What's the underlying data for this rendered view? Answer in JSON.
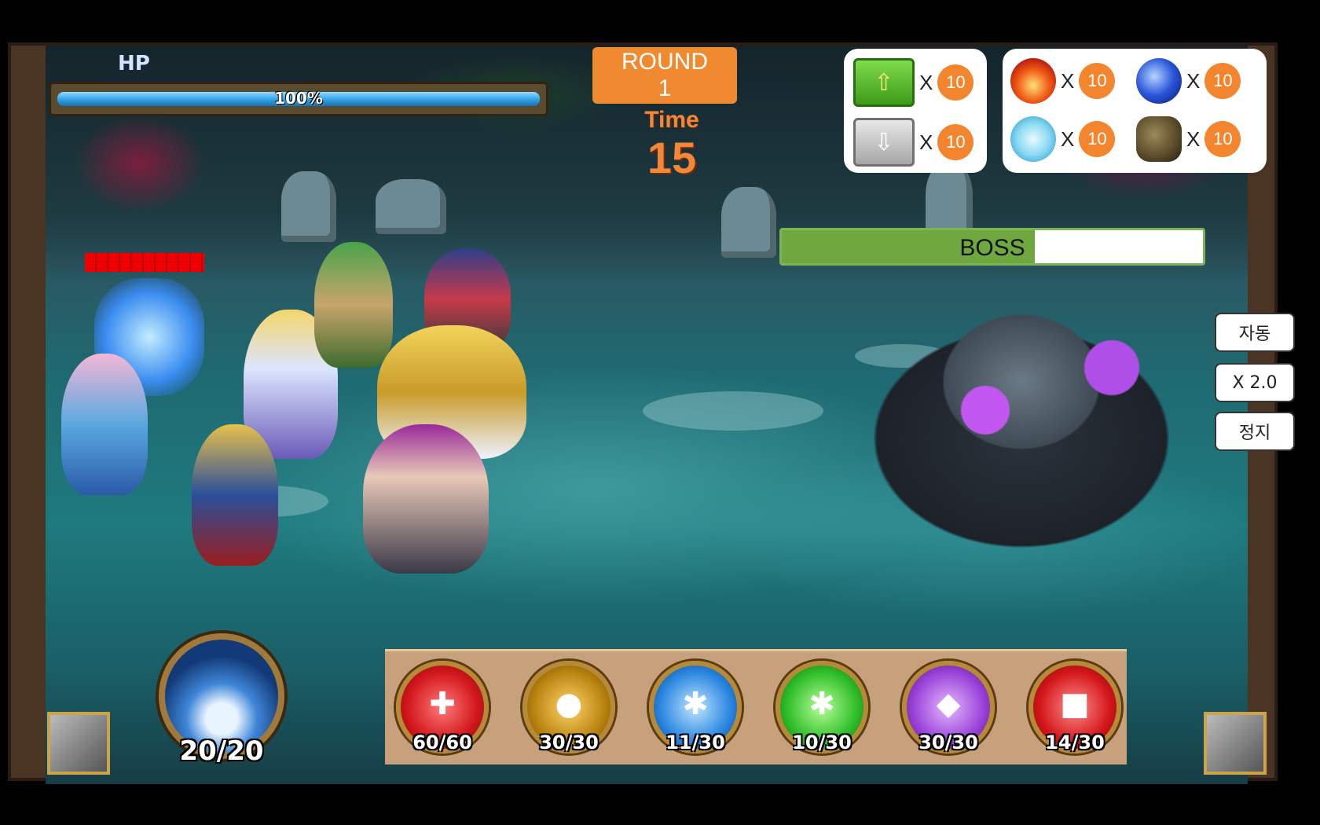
{
  "hud": {
    "hp_label": "HP",
    "hp_percent_text": "100%",
    "hp_fraction": 1.0,
    "round_label": "ROUND",
    "round_number": "1",
    "time_label": "Time",
    "time_value": "15"
  },
  "inventory": {
    "x_symbol": "X",
    "arrows": [
      {
        "icon": "arrow-up-icon",
        "count": "10"
      },
      {
        "icon": "arrow-down-icon",
        "count": "10"
      }
    ],
    "elements": [
      {
        "icon": "fire-element-icon",
        "count": "10"
      },
      {
        "icon": "water-element-icon",
        "count": "10"
      },
      {
        "icon": "wind-element-icon",
        "count": "10"
      },
      {
        "icon": "earth-element-icon",
        "count": "10"
      }
    ]
  },
  "boss": {
    "label": "BOSS",
    "hp_fraction": 0.6
  },
  "side_buttons": {
    "auto": "자동",
    "speed": "X 2.0",
    "stop": "정지"
  },
  "skills": [
    {
      "icon": "heal-heart-icon",
      "count": "60/60"
    },
    {
      "icon": "voodoo-doll-icon",
      "count": "30/30"
    },
    {
      "icon": "ice-shuriken-icon",
      "count": "11/30"
    },
    {
      "icon": "leaf-shuriken-icon",
      "count": "10/30"
    },
    {
      "icon": "arcane-blade-icon",
      "count": "30/30"
    },
    {
      "icon": "power-strike-icon",
      "count": "14/30"
    }
  ],
  "mana": {
    "count": "20/20"
  },
  "colors": {
    "accent_orange": "#f08a30",
    "hp_blue": "#2a9de0",
    "boss_green": "#6ea83e"
  }
}
